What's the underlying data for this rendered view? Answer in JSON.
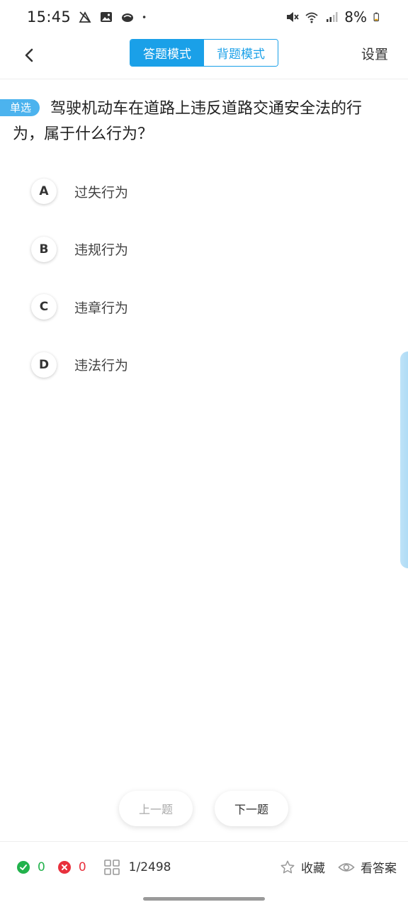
{
  "status_bar": {
    "time": "15:45",
    "battery": "8%"
  },
  "header": {
    "mode_answer": "答题模式",
    "mode_memorize": "背题模式",
    "settings": "设置"
  },
  "question": {
    "type_badge": "单选",
    "text": "驾驶机动车在道路上违反道路交通安全法的行为，属于什么行为？"
  },
  "options": [
    {
      "letter": "A",
      "text": "过失行为"
    },
    {
      "letter": "B",
      "text": "违规行为"
    },
    {
      "letter": "C",
      "text": "违章行为"
    },
    {
      "letter": "D",
      "text": "违法行为"
    }
  ],
  "navigation": {
    "prev": "上一题",
    "next": "下一题"
  },
  "bottom_bar": {
    "correct_count": "0",
    "wrong_count": "0",
    "progress": "1/2498",
    "favorite": "收藏",
    "view_answer": "看答案"
  },
  "colors": {
    "accent": "#1aa0e8",
    "correct": "#22b24c",
    "wrong": "#e8303c"
  }
}
